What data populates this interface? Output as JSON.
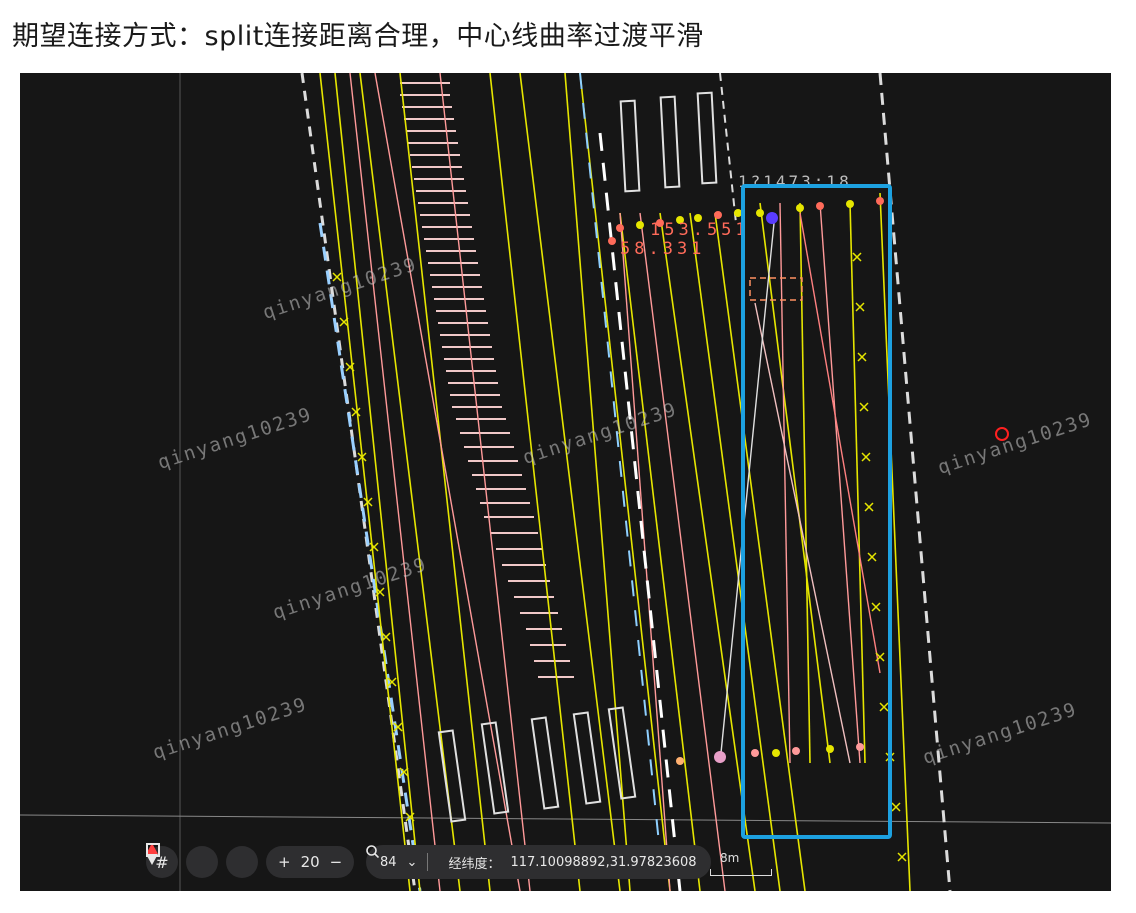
{
  "title": "期望连接方式：split连接距离合理，中心线曲率过渡平滑",
  "header_measurement": "1?1473:18",
  "measurements": [
    "153.551",
    "58.331"
  ],
  "watermark_text": "qinyang10239",
  "toolbar": {
    "icons": [
      "grid-icon",
      "compass-icon",
      "square-select-icon"
    ],
    "zoom_plus": "+",
    "zoom_value": "20",
    "zoom_minus": "−"
  },
  "coord_bar": {
    "scale_value": "84",
    "label": "经纬度：",
    "coordinates": "117.10098892,31.97823608"
  },
  "scale_bar": "8m",
  "colors": {
    "lane_yellow": "#e6e600",
    "lane_pink": "#ff9a9a",
    "selection_box": "#1da1e0",
    "measurement": "#ff6b5a",
    "marker_red": "#ff2020"
  }
}
